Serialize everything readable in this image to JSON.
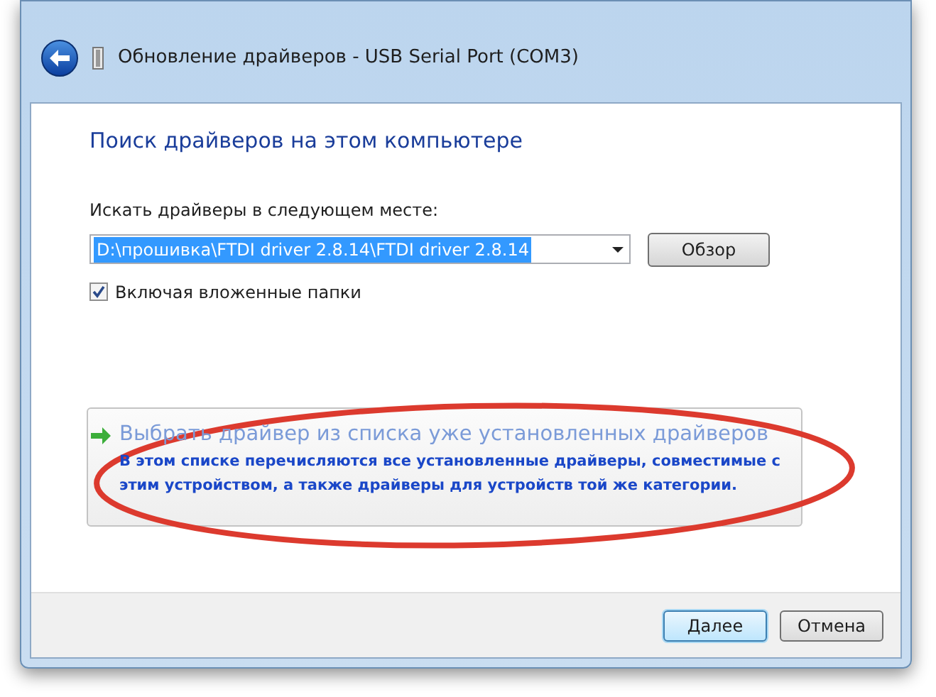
{
  "window": {
    "title": "Обновление драйверов - USB Serial Port (COM3)"
  },
  "heading": "Поиск драйверов на этом компьютере",
  "location": {
    "label": "Искать драйверы в следующем месте:",
    "value": "D:\\прошивка\\FTDI driver 2.8.14\\FTDI driver 2.8.14",
    "selected": true
  },
  "browse_button": "Обзор",
  "include_subfolders": {
    "label": "Включая вложенные папки",
    "checked": true
  },
  "command_link": {
    "title": "Выбрать драйвер из списка уже установленных драйверов",
    "description": "В этом списке перечисляются все установленные драйверы, совместимые с этим устройством, а также драйверы для устройств той же категории."
  },
  "buttons": [
    {
      "label": "Далее",
      "default": true
    },
    {
      "label": "Отмена",
      "default": false
    }
  ]
}
